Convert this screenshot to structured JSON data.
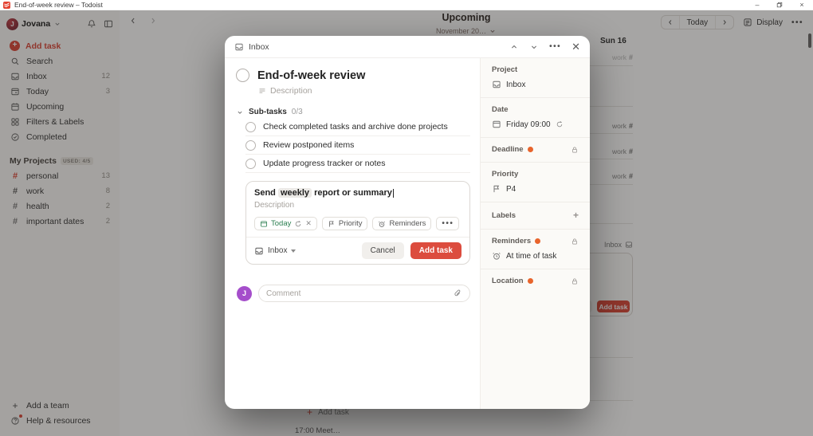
{
  "titlebar": {
    "title": "End-of-week review – Todoist"
  },
  "header": {
    "user_name": "Jovana",
    "view_title": "Upcoming",
    "view_subtitle": "November 20…",
    "nav_today": "Today",
    "display_label": "Display"
  },
  "sidebar": {
    "add_task": "Add task",
    "items": [
      {
        "label": "Search",
        "count": ""
      },
      {
        "label": "Inbox",
        "count": "12"
      },
      {
        "label": "Today",
        "count": "3"
      },
      {
        "label": "Upcoming",
        "count": ""
      },
      {
        "label": "Filters & Labels",
        "count": ""
      },
      {
        "label": "Completed",
        "count": ""
      }
    ],
    "projects_header": "My Projects",
    "used_badge": "USED: 4/5",
    "projects": [
      {
        "name": "personal",
        "count": "13",
        "color": "#dc4c3e"
      },
      {
        "name": "work",
        "count": "8",
        "color": "#5f5f5f"
      },
      {
        "name": "health",
        "count": "2",
        "color": "#7d7d7d"
      },
      {
        "name": "important dates",
        "count": "2",
        "color": "#7d7d7d"
      }
    ],
    "add_team": "Add a team",
    "help": "Help & resources"
  },
  "background": {
    "day_header": "Sun 16",
    "task_project_label": "work",
    "inbox_label": "Inbox",
    "add_task_button": "Add task",
    "add_task_row": "Add task",
    "bottom_partial": "17:00 Meet…"
  },
  "modal": {
    "breadcrumb": "Inbox",
    "title": "End-of-week review",
    "description_placeholder": "Description",
    "subtasks_label": "Sub-tasks",
    "subtasks_count": "0/3",
    "subtasks": [
      "Check completed tasks and archive done projects",
      "Review postponed items",
      "Update progress tracker or notes"
    ],
    "editor": {
      "text_before": "Send ",
      "text_highlight": "weekly",
      "text_after": " report or summary",
      "description_placeholder": "Description",
      "chip_today": "Today",
      "chip_priority": "Priority",
      "chip_reminders": "Reminders",
      "project": "Inbox",
      "cancel": "Cancel",
      "submit": "Add task"
    },
    "comment": {
      "avatar": "J",
      "placeholder": "Comment"
    }
  },
  "panel": {
    "project_label": "Project",
    "project_value": "Inbox",
    "date_label": "Date",
    "date_value": "Friday 09:00",
    "deadline_label": "Deadline",
    "priority_label": "Priority",
    "priority_value": "P4",
    "labels_label": "Labels",
    "reminders_label": "Reminders",
    "reminders_value": "At time of task",
    "location_label": "Location"
  },
  "colors": {
    "accent_red": "#dc4c3e",
    "brand_red": "#e44332",
    "pro_badge_orange": "#e8642c",
    "today_green": "#2a7e4f",
    "avatar_purple": "#a54ecb",
    "sidebar_bg": "#fcfaf8"
  },
  "icons": [
    "todoist-logo",
    "minimize",
    "restore",
    "close",
    "bell",
    "panel-toggle",
    "chevron-left",
    "chevron-right",
    "chevron-down",
    "chevron-up",
    "search",
    "inbox-tray",
    "calendar",
    "grid",
    "circle-check",
    "hash",
    "plus",
    "help-circle",
    "display",
    "more-dots",
    "flag",
    "alarm-clock",
    "recurring",
    "paperclip",
    "lock",
    "attachment"
  ]
}
